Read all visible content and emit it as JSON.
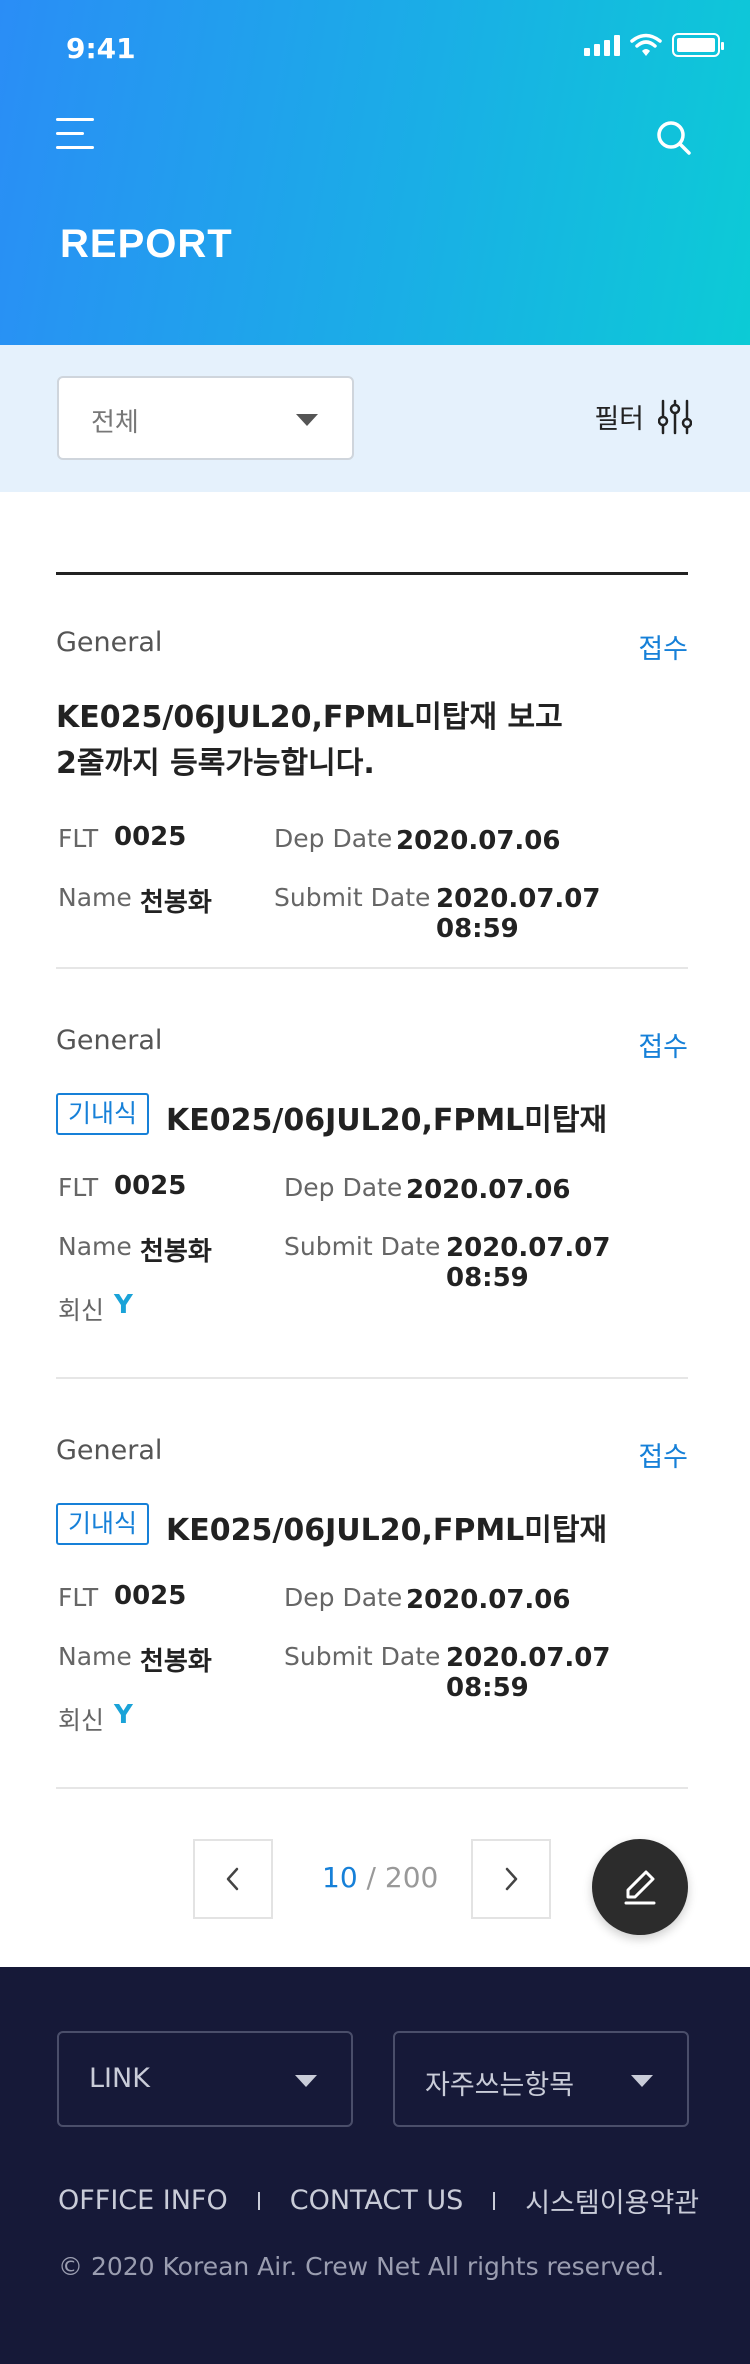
{
  "status_bar": {
    "time": "9:41"
  },
  "header": {
    "title": "REPORT"
  },
  "filter": {
    "select_value": "전체",
    "filter_label": "필터"
  },
  "reports": [
    {
      "category": "General",
      "status": "접수",
      "title_line1": "KE025/06JUL20,FPML미탑재 보고",
      "title_line2": "2줄까지 등록가능합니다.",
      "flt_label": "FLT",
      "flt": "0025",
      "dep_date_label": "Dep Date",
      "dep_date": "2020.07.06",
      "name_label": "Name",
      "name": "천봉화",
      "submit_date_label": "Submit Date",
      "submit_date": "2020.07.07 08:59"
    },
    {
      "category": "General",
      "status": "접수",
      "badge": "기내식",
      "title": "KE025/06JUL20,FPML미탑재",
      "flt_label": "FLT",
      "flt": "0025",
      "dep_date_label": "Dep Date",
      "dep_date": "2020.07.06",
      "name_label": "Name",
      "name": "천봉화",
      "submit_date_label": "Submit Date",
      "submit_date": "2020.07.07 08:59",
      "reply_label": "회신",
      "reply": "Y"
    },
    {
      "category": "General",
      "status": "접수",
      "badge": "기내식",
      "title": "KE025/06JUL20,FPML미탑재",
      "flt_label": "FLT",
      "flt": "0025",
      "dep_date_label": "Dep Date",
      "dep_date": "2020.07.06",
      "name_label": "Name",
      "name": "천봉화",
      "submit_date_label": "Submit Date",
      "submit_date": "2020.07.07 08:59",
      "reply_label": "회신",
      "reply": "Y"
    }
  ],
  "pagination": {
    "current": "10",
    "separator": " / ",
    "total": "200"
  },
  "footer": {
    "link_select": "LINK",
    "faq_select": "자주쓰는항목",
    "links": [
      "OFFICE INFO",
      "CONTACT US",
      "시스템이용약관"
    ],
    "copyright": "© 2020 Korean Air. Crew Net  All rights reserved."
  },
  "colors": {
    "accent": "#1680d8",
    "reply": "#1aa3d8",
    "footer_bg": "#161938",
    "filter_bg": "#e5f1fc",
    "header_start": "#2a8df6",
    "header_end": "#0ccbd6"
  }
}
